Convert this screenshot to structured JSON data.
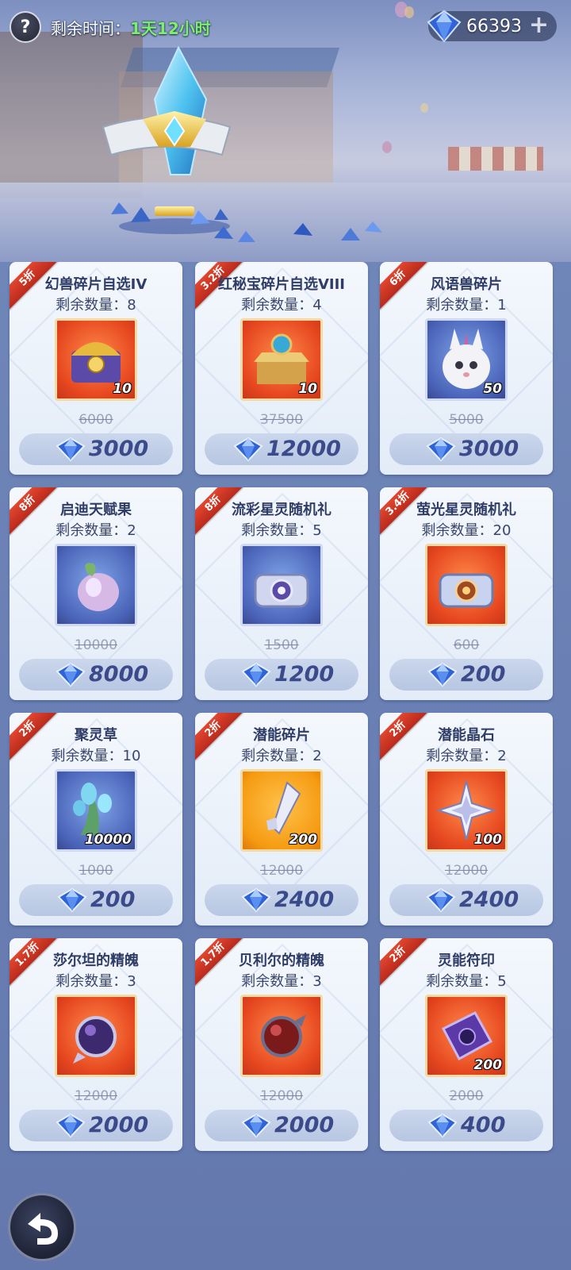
{
  "header": {
    "help_icon": "question-mark-icon",
    "remain_label": "剩余时间：",
    "remain_value": "1天12小时",
    "currency_icon": "diamond-gem-icon",
    "currency_amount": "66393",
    "add_icon": "plus-icon"
  },
  "colors": {
    "discount_ribbon": "#d63a26",
    "price_text": "#3a4a8a",
    "remain_value": "#7cf06a"
  },
  "items": [
    {
      "discount": "5折",
      "name": "幻兽碎片自选IV",
      "stock": "剩余数量：8",
      "qty": "10",
      "old_price": "6000",
      "price": "3000",
      "icon": "golden-chest-icon"
    },
    {
      "discount": "3.2折",
      "name": "红秘宝碎片自选VIII",
      "stock": "剩余数量：4",
      "qty": "10",
      "old_price": "37500",
      "price": "12000",
      "icon": "orb-chest-icon"
    },
    {
      "discount": "6折",
      "name": "风语兽碎片",
      "stock": "剩余数量：1",
      "qty": "50",
      "old_price": "5000",
      "price": "3000",
      "icon": "white-beast-icon"
    },
    {
      "discount": "8折",
      "name": "启迪天赋果",
      "stock": "剩余数量：2",
      "qty": "",
      "old_price": "10000",
      "price": "8000",
      "icon": "talent-fruit-icon"
    },
    {
      "discount": "8折",
      "name": "流彩星灵随机礼",
      "stock": "剩余数量：5",
      "qty": "",
      "old_price": "1500",
      "price": "1200",
      "icon": "silver-chest-icon"
    },
    {
      "discount": "3.4折",
      "name": "萤光星灵随机礼",
      "stock": "剩余数量：20",
      "qty": "",
      "old_price": "600",
      "price": "200",
      "icon": "firefly-chest-icon"
    },
    {
      "discount": "2折",
      "name": "聚灵草",
      "stock": "剩余数量：10",
      "qty": "10000",
      "old_price": "1000",
      "price": "200",
      "icon": "spirit-grass-icon"
    },
    {
      "discount": "2折",
      "name": "潜能碎片",
      "stock": "剩余数量：2",
      "qty": "200",
      "old_price": "12000",
      "price": "2400",
      "icon": "potential-shard-icon"
    },
    {
      "discount": "2折",
      "name": "潜能晶石",
      "stock": "剩余数量：2",
      "qty": "100",
      "old_price": "12000",
      "price": "2400",
      "icon": "potential-crystal-icon"
    },
    {
      "discount": "1.7折",
      "name": "莎尔坦的精魄",
      "stock": "剩余数量：3",
      "qty": "",
      "old_price": "12000",
      "price": "2000",
      "icon": "purple-soul-orb-icon"
    },
    {
      "discount": "1.7折",
      "name": "贝利尔的精魄",
      "stock": "剩余数量：3",
      "qty": "",
      "old_price": "12000",
      "price": "2000",
      "icon": "red-soul-orb-icon"
    },
    {
      "discount": "2折",
      "name": "灵能符印",
      "stock": "剩余数量：5",
      "qty": "200",
      "old_price": "2000",
      "price": "400",
      "icon": "psionic-seal-icon"
    }
  ],
  "footer": {
    "back_icon": "back-arrow-icon"
  }
}
